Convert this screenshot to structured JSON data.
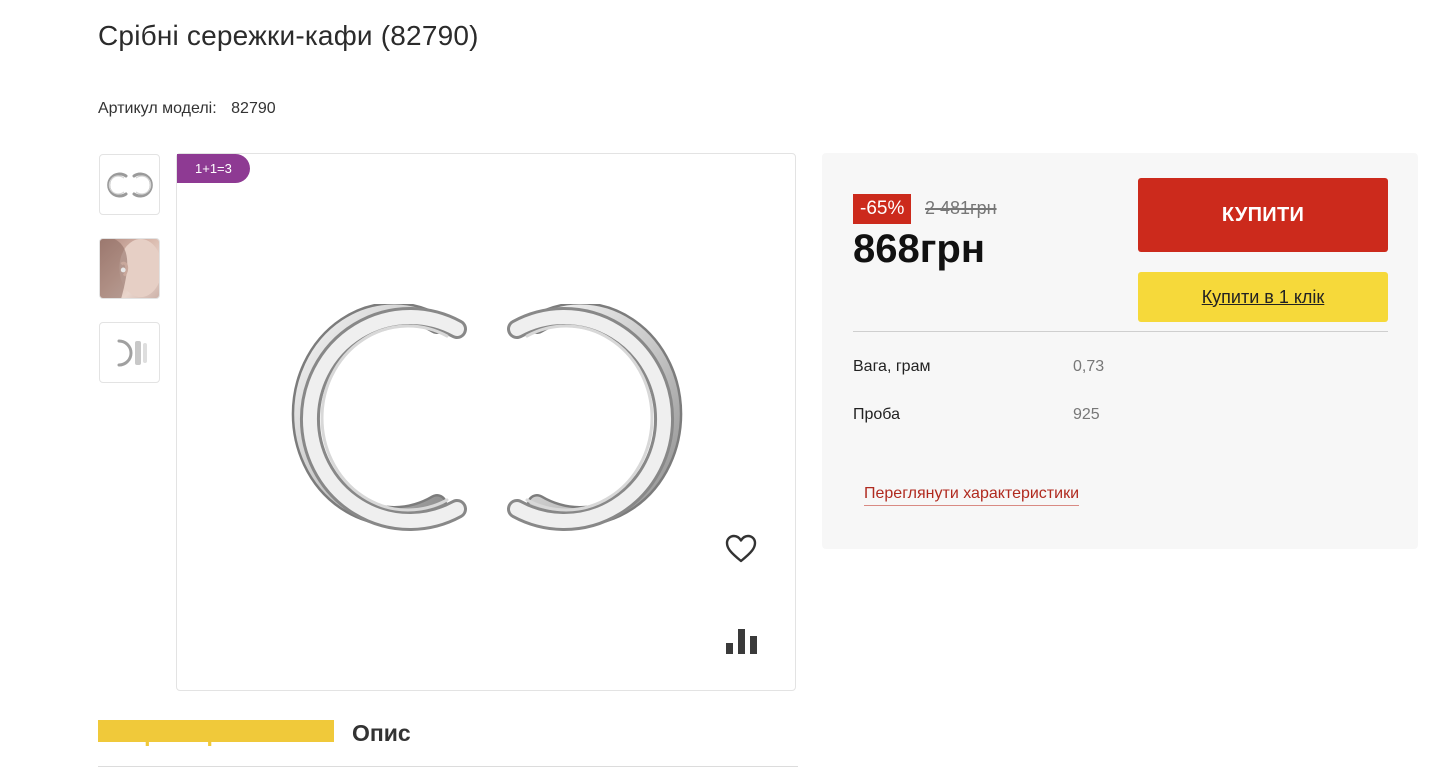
{
  "product": {
    "title": "Срібні сережки-кафи (82790)",
    "sku_label": "Артикул моделі:",
    "sku_value": "82790"
  },
  "gallery": {
    "badge": "1+1=3",
    "thumbnails": [
      "earrings-front",
      "model-photo",
      "earrings-side"
    ]
  },
  "pricing": {
    "discount": "-65%",
    "old_price": "2 481грн",
    "price": "868грн",
    "buy_label": "КУПИТИ",
    "one_click_label": "Купити в 1 клік"
  },
  "specs": [
    {
      "label": "Вага, грам",
      "value": "0,73"
    },
    {
      "label": "Проба",
      "value": "925"
    }
  ],
  "specs_link": "Переглянути характеристики",
  "tabs": [
    {
      "label": "Характеристики",
      "active": true
    },
    {
      "label": "Опис",
      "active": false
    }
  ],
  "colors": {
    "accent_red": "#cc2a1c",
    "accent_yellow": "#f6d93a",
    "badge_purple": "#8e3a93",
    "tab_active": "#f0c93a"
  },
  "icons": [
    "heart-icon",
    "compare-chart-icon"
  ]
}
